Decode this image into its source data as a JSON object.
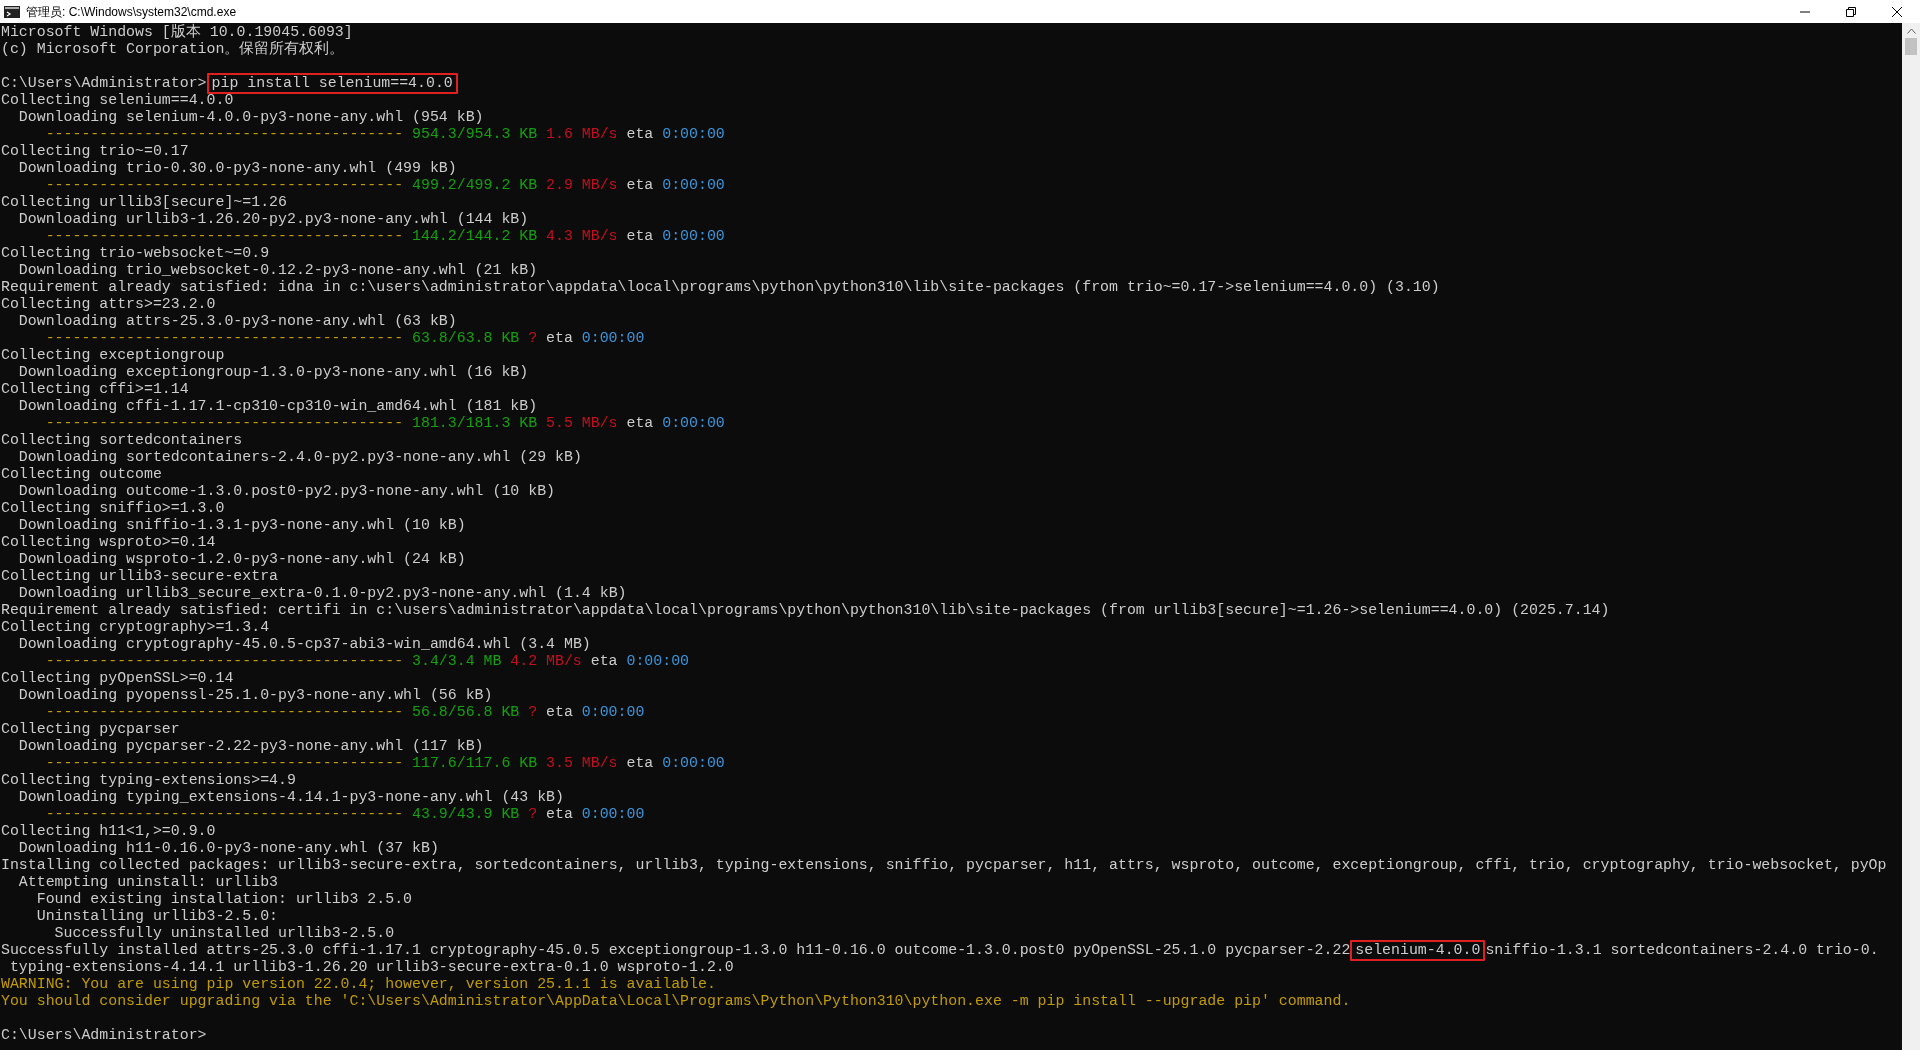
{
  "window": {
    "title": "管理员: C:\\Windows\\system32\\cmd.exe"
  },
  "console": {
    "lines": [
      {
        "kind": "text",
        "text": "Microsoft Windows [版本 10.0.19045.6093]"
      },
      {
        "kind": "text",
        "text": "(c) Microsoft Corporation。保留所有权利。"
      },
      {
        "kind": "blank"
      },
      {
        "kind": "highlighted",
        "before": "C:\\Users\\Administrator>",
        "highlight": "pip install selenium==4.0.0"
      },
      {
        "kind": "text",
        "text": "Collecting selenium==4.0.0"
      },
      {
        "kind": "text",
        "text": "  Downloading selenium-4.0.0-py3-none-any.whl (954 kB)"
      },
      {
        "kind": "progress",
        "bar": "----------------------------------------",
        "size": "954.3/954.3 KB",
        "speed": "1.6 MB/s",
        "eta_label": "eta",
        "time": "0:00:00"
      },
      {
        "kind": "text",
        "text": "Collecting trio~=0.17"
      },
      {
        "kind": "text",
        "text": "  Downloading trio-0.30.0-py3-none-any.whl (499 kB)"
      },
      {
        "kind": "progress",
        "bar": "----------------------------------------",
        "size": "499.2/499.2 KB",
        "speed": "2.9 MB/s",
        "eta_label": "eta",
        "time": "0:00:00"
      },
      {
        "kind": "text",
        "text": "Collecting urllib3[secure]~=1.26"
      },
      {
        "kind": "text",
        "text": "  Downloading urllib3-1.26.20-py2.py3-none-any.whl (144 kB)"
      },
      {
        "kind": "progress",
        "bar": "----------------------------------------",
        "size": "144.2/144.2 KB",
        "speed": "4.3 MB/s",
        "eta_label": "eta",
        "time": "0:00:00"
      },
      {
        "kind": "text",
        "text": "Collecting trio-websocket~=0.9"
      },
      {
        "kind": "text",
        "text": "  Downloading trio_websocket-0.12.2-py3-none-any.whl (21 kB)"
      },
      {
        "kind": "text",
        "text": "Requirement already satisfied: idna in c:\\users\\administrator\\appdata\\local\\programs\\python\\python310\\lib\\site-packages (from trio~=0.17->selenium==4.0.0) (3.10)"
      },
      {
        "kind": "text",
        "text": "Collecting attrs>=23.2.0"
      },
      {
        "kind": "text",
        "text": "  Downloading attrs-25.3.0-py3-none-any.whl (63 kB)"
      },
      {
        "kind": "progress",
        "bar": "----------------------------------------",
        "size": "63.8/63.8 KB",
        "speed": "?",
        "eta_label": "eta",
        "time": "0:00:00"
      },
      {
        "kind": "text",
        "text": "Collecting exceptiongroup"
      },
      {
        "kind": "text",
        "text": "  Downloading exceptiongroup-1.3.0-py3-none-any.whl (16 kB)"
      },
      {
        "kind": "text",
        "text": "Collecting cffi>=1.14"
      },
      {
        "kind": "text",
        "text": "  Downloading cffi-1.17.1-cp310-cp310-win_amd64.whl (181 kB)"
      },
      {
        "kind": "progress",
        "bar": "----------------------------------------",
        "size": "181.3/181.3 KB",
        "speed": "5.5 MB/s",
        "eta_label": "eta",
        "time": "0:00:00"
      },
      {
        "kind": "text",
        "text": "Collecting sortedcontainers"
      },
      {
        "kind": "text",
        "text": "  Downloading sortedcontainers-2.4.0-py2.py3-none-any.whl (29 kB)"
      },
      {
        "kind": "text",
        "text": "Collecting outcome"
      },
      {
        "kind": "text",
        "text": "  Downloading outcome-1.3.0.post0-py2.py3-none-any.whl (10 kB)"
      },
      {
        "kind": "text",
        "text": "Collecting sniffio>=1.3.0"
      },
      {
        "kind": "text",
        "text": "  Downloading sniffio-1.3.1-py3-none-any.whl (10 kB)"
      },
      {
        "kind": "text",
        "text": "Collecting wsproto>=0.14"
      },
      {
        "kind": "text",
        "text": "  Downloading wsproto-1.2.0-py3-none-any.whl (24 kB)"
      },
      {
        "kind": "text",
        "text": "Collecting urllib3-secure-extra"
      },
      {
        "kind": "text",
        "text": "  Downloading urllib3_secure_extra-0.1.0-py2.py3-none-any.whl (1.4 kB)"
      },
      {
        "kind": "text",
        "text": "Requirement already satisfied: certifi in c:\\users\\administrator\\appdata\\local\\programs\\python\\python310\\lib\\site-packages (from urllib3[secure]~=1.26->selenium==4.0.0) (2025.7.14)"
      },
      {
        "kind": "text",
        "text": "Collecting cryptography>=1.3.4"
      },
      {
        "kind": "text",
        "text": "  Downloading cryptography-45.0.5-cp37-abi3-win_amd64.whl (3.4 MB)"
      },
      {
        "kind": "progress",
        "bar": "----------------------------------------",
        "size": "3.4/3.4 MB",
        "speed": "4.2 MB/s",
        "eta_label": "eta",
        "time": "0:00:00"
      },
      {
        "kind": "text",
        "text": "Collecting pyOpenSSL>=0.14"
      },
      {
        "kind": "text",
        "text": "  Downloading pyopenssl-25.1.0-py3-none-any.whl (56 kB)"
      },
      {
        "kind": "progress",
        "bar": "----------------------------------------",
        "size": "56.8/56.8 KB",
        "speed": "?",
        "eta_label": "eta",
        "time": "0:00:00"
      },
      {
        "kind": "text",
        "text": "Collecting pycparser"
      },
      {
        "kind": "text",
        "text": "  Downloading pycparser-2.22-py3-none-any.whl (117 kB)"
      },
      {
        "kind": "progress",
        "bar": "----------------------------------------",
        "size": "117.6/117.6 KB",
        "speed": "3.5 MB/s",
        "eta_label": "eta",
        "time": "0:00:00"
      },
      {
        "kind": "text",
        "text": "Collecting typing-extensions>=4.9"
      },
      {
        "kind": "text",
        "text": "  Downloading typing_extensions-4.14.1-py3-none-any.whl (43 kB)"
      },
      {
        "kind": "progress",
        "bar": "----------------------------------------",
        "size": "43.9/43.9 KB",
        "speed": "?",
        "eta_label": "eta",
        "time": "0:00:00"
      },
      {
        "kind": "text",
        "text": "Collecting h11<1,>=0.9.0"
      },
      {
        "kind": "text",
        "text": "  Downloading h11-0.16.0-py3-none-any.whl (37 kB)"
      },
      {
        "kind": "text",
        "text": "Installing collected packages: urllib3-secure-extra, sortedcontainers, urllib3, typing-extensions, sniffio, pycparser, h11, attrs, wsproto, outcome, exceptiongroup, cffi, trio, cryptography, trio-websocket, pyOp"
      },
      {
        "kind": "text",
        "text": "  Attempting uninstall: urllib3"
      },
      {
        "kind": "text",
        "text": "    Found existing installation: urllib3 2.5.0"
      },
      {
        "kind": "text",
        "text": "    Uninstalling urllib3-2.5.0:"
      },
      {
        "kind": "text",
        "text": "      Successfully uninstalled urllib3-2.5.0"
      },
      {
        "kind": "highlighted",
        "before": "Successfully installed attrs-25.3.0 cffi-1.17.1 cryptography-45.0.5 exceptiongroup-1.3.0 h11-0.16.0 outcome-1.3.0.post0 pyOpenSSL-25.1.0 pycparser-2.22",
        "highlight": "selenium-4.0.0",
        "after": "sniffio-1.3.1 sortedcontainers-2.4.0 trio-0."
      },
      {
        "kind": "text",
        "text": " typing-extensions-4.14.1 urllib3-1.26.20 urllib3-secure-extra-0.1.0 wsproto-1.2.0"
      },
      {
        "kind": "warning",
        "text": "WARNING: You are using pip version 22.0.4; however, version 25.1.1 is available."
      },
      {
        "kind": "warning",
        "text": "You should consider upgrading via the 'C:\\Users\\Administrator\\AppData\\Local\\Programs\\Python\\Python310\\python.exe -m pip install --upgrade pip' command."
      },
      {
        "kind": "blank"
      },
      {
        "kind": "text",
        "text": "C:\\Users\\Administrator>"
      }
    ]
  }
}
